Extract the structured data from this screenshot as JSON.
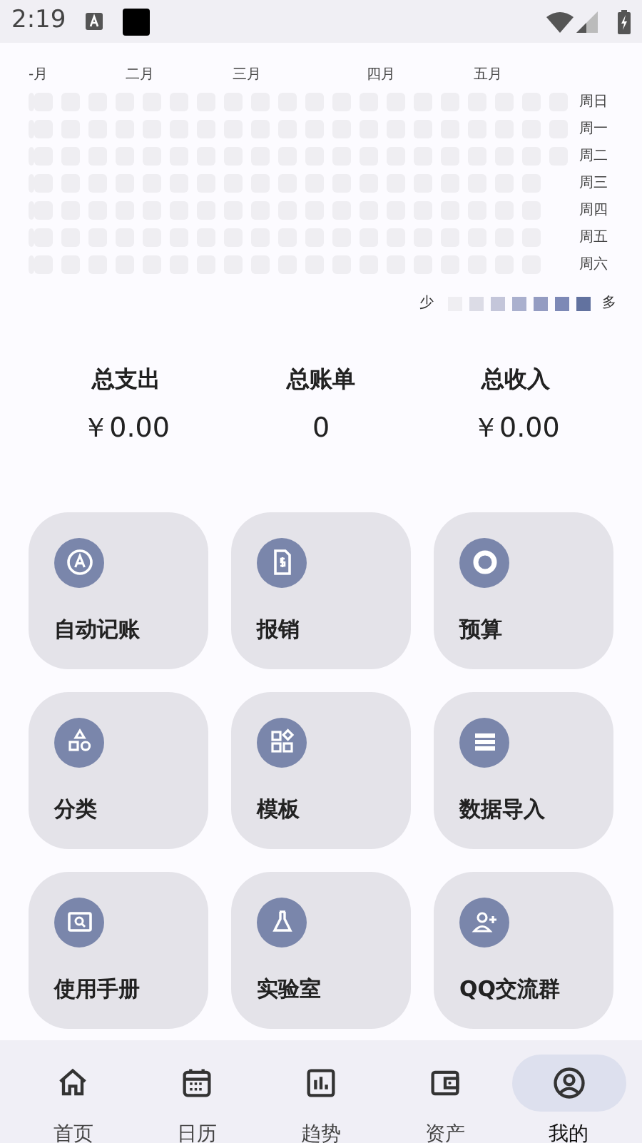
{
  "status_bar": {
    "time": "2:19"
  },
  "heatmap": {
    "months": [
      "-月",
      "二月",
      "三月",
      "四月",
      "五月"
    ],
    "weekdays": [
      "周日",
      "周一",
      "周二",
      "周三",
      "周四",
      "周五",
      "周六"
    ],
    "legend_low": "少",
    "legend_high": "多"
  },
  "summary": [
    {
      "label": "总支出",
      "value": "￥0.00"
    },
    {
      "label": "总账单",
      "value": "0"
    },
    {
      "label": "总收入",
      "value": "￥0.00"
    }
  ],
  "tiles": [
    {
      "label": "自动记账"
    },
    {
      "label": "报销"
    },
    {
      "label": "预算"
    },
    {
      "label": "分类"
    },
    {
      "label": "模板"
    },
    {
      "label": "数据导入"
    },
    {
      "label": "使用手册"
    },
    {
      "label": "实验室"
    },
    {
      "label": "QQ交流群"
    }
  ],
  "nav": [
    {
      "label": "首页",
      "selected": false
    },
    {
      "label": "日历",
      "selected": false
    },
    {
      "label": "趋势",
      "selected": false
    },
    {
      "label": "资产",
      "selected": false
    },
    {
      "label": "我的",
      "selected": true
    }
  ]
}
